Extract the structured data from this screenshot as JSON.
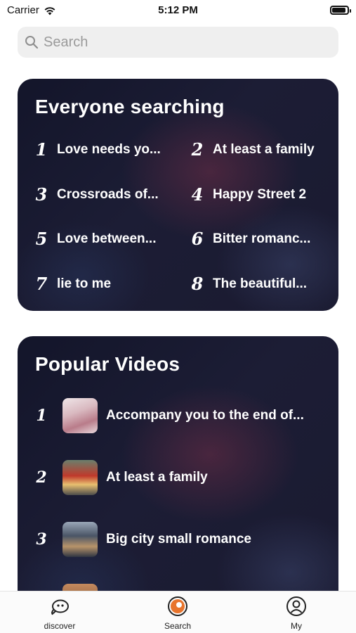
{
  "status_bar": {
    "carrier": "Carrier",
    "time": "5:12 PM"
  },
  "search": {
    "placeholder": "Search",
    "value": ""
  },
  "trending": {
    "title": "Everyone searching",
    "items": [
      {
        "rank": "1",
        "label": "Love needs yo..."
      },
      {
        "rank": "2",
        "label": "At least a family"
      },
      {
        "rank": "3",
        "label": "Crossroads of..."
      },
      {
        "rank": "4",
        "label": "Happy Street 2"
      },
      {
        "rank": "5",
        "label": "Love between..."
      },
      {
        "rank": "6",
        "label": "Bitter romanc..."
      },
      {
        "rank": "7",
        "label": "lie to me"
      },
      {
        "rank": "8",
        "label": "The beautiful..."
      }
    ]
  },
  "popular": {
    "title": "Popular Videos",
    "items": [
      {
        "rank": "1",
        "title": "Accompany you to the end of..."
      },
      {
        "rank": "2",
        "title": "At least a family"
      },
      {
        "rank": "3",
        "title": "Big city small romance"
      }
    ]
  },
  "tab_bar": {
    "tabs": [
      {
        "label": "discover",
        "icon": "discover-icon"
      },
      {
        "label": "Search",
        "icon": "search-tab-icon",
        "active": true
      },
      {
        "label": "My",
        "icon": "profile-icon"
      }
    ]
  },
  "colors": {
    "accent": "#e8742c",
    "card_bg": "#1a1b31",
    "search_bg": "#efefef"
  }
}
